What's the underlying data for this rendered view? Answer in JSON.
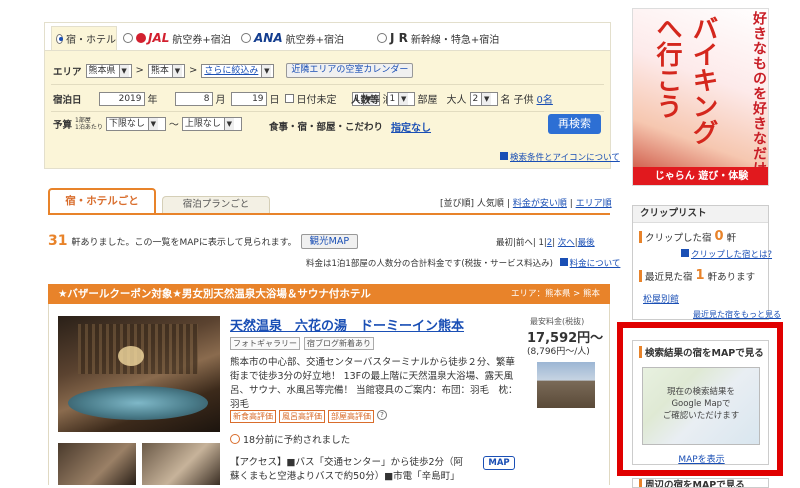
{
  "tabs": [
    {
      "label": "宿・ホテル"
    },
    {
      "brand": "JAL",
      "label": "航空券+宿泊"
    },
    {
      "brand": "ANA",
      "label": "航空券+宿泊"
    },
    {
      "brand": "J R",
      "label": "新幹線・特急+宿泊"
    }
  ],
  "area": {
    "label": "エリア",
    "pref": "熊本県",
    "city": "熊本",
    "refine": "さらに絞込み",
    "nearby_btn": "近隣エリアの空室カレンダー",
    "arrow": ">"
  },
  "dates": {
    "label": "宿泊日",
    "year": "2019",
    "year_unit": "年",
    "month": "8",
    "month_unit": "月",
    "day": "19",
    "day_unit": "日",
    "undecided": "日付未定",
    "nights": "1",
    "nights_unit": "泊"
  },
  "guests": {
    "label": "人数等",
    "rooms": "1",
    "rooms_unit": "部屋",
    "adult_label": "大人",
    "adults": "2",
    "adult_unit": "名",
    "child_label": "子供",
    "children": "0名"
  },
  "budget": {
    "label": "予算",
    "sub1": "1部屋",
    "sub2": "1泊あたり",
    "min": "下限なし",
    "tilde": "〜",
    "max": "上限なし"
  },
  "cond": {
    "label": "食事・宿・部屋・こだわり",
    "value": "指定なし"
  },
  "research_btn": "再検索",
  "help_link": "検索条件とアイコンについて",
  "result_tabs": [
    {
      "label": "宿・ホテルごと"
    },
    {
      "label": "宿泊プランごと"
    }
  ],
  "sort": {
    "label": "[並び順]",
    "popular": "人気順",
    "cheap": "料金が安い順",
    "area": "エリア順"
  },
  "result": {
    "count": "31",
    "text": "軒ありました。この一覧をMAPに表示して見られます。",
    "map_btn": "観光MAP"
  },
  "pager": {
    "first": "最初",
    "prev": "前へ",
    "p1": "1",
    "p2": "2",
    "next": "次へ",
    "last": "最後"
  },
  "price_note": "料金は1泊1部屋の人数分の合計料金です(税抜・サービス料込み)",
  "price_note_link": "料金について",
  "banner": {
    "title": "★バザールクーポン対象★男女別天然温泉大浴場＆サウナ付ホテル",
    "area": "エリア：熊本県 > 熊本"
  },
  "hotel": {
    "name": "天然温泉　六花の湯　ドーミーイン熊本",
    "badges": [
      "フォトギャラリー",
      "宿ブログ新着あり"
    ],
    "desc": "熊本市の中心部、交通センターバスターミナルから徒歩２分、繁華街まで徒歩3分の好立地！ 13Fの最上階に天然温泉大浴場、露天風呂、サウナ、水風呂等完備！ 当館寝具のご案内：布団：羽毛　枕：羽毛",
    "eval_tags": [
      "新食高評価",
      "風呂高評価",
      "部屋高評価"
    ],
    "reserved": "18分前に予約されました",
    "access": "【アクセス】■バス「交通センター」から徒歩2分（阿蘇くまもと空港よりバスで約50分）■市電「辛島町」",
    "map_btn": "MAP",
    "price_label": "最安料金(税抜)",
    "price": "17,592円〜",
    "price_per": "(8,796円〜/人)"
  },
  "ad": {
    "line1": "好きなものを好きなだけ",
    "line2": "バイキングへ行こう",
    "brand": "じゃらん 遊び・体験"
  },
  "clip": {
    "title": "クリップリスト",
    "clipped": "クリップした宿",
    "clipped_count": "0",
    "clipped_unit": "軒",
    "what": "クリップした宿とは?",
    "recent": "最近見た宿",
    "recent_count": "1",
    "recent_unit": "軒あります",
    "recent_hotel": "松屋別館",
    "recent_more": "最近見た宿をもっと見る"
  },
  "mapbox": {
    "title": "検索結果の宿をMAPで見る",
    "text1": "現在の検索結果を",
    "text2": "Google Mapで",
    "text3": "ご確認いただけます",
    "link": "MAPを表示"
  },
  "nearby": {
    "title": "周辺の宿をMAPで見る"
  },
  "colors": {
    "orange": "#e8832a",
    "red": "#d23",
    "blue": "#2d6fd4",
    "highlight": "#e00000"
  }
}
